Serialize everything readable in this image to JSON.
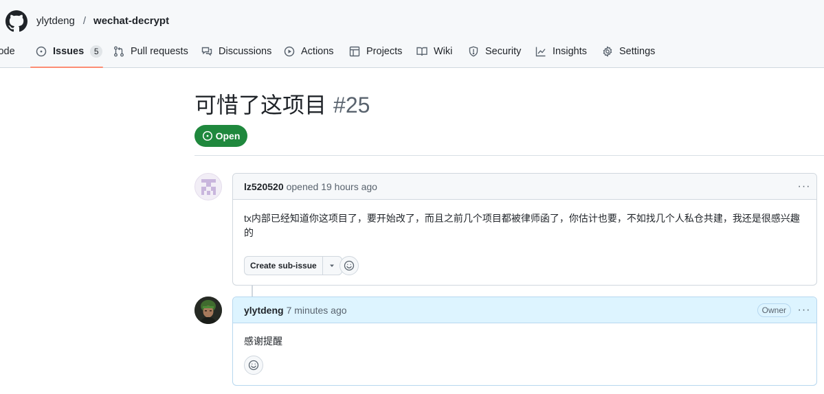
{
  "repo": {
    "owner": "ylytdeng",
    "separator": "/",
    "name": "wechat-decrypt"
  },
  "tabs": [
    {
      "label": "Code",
      "icon": "code-icon"
    },
    {
      "label": "Issues",
      "icon": "issue-opened-icon",
      "counter": "5",
      "active": true
    },
    {
      "label": "Pull requests",
      "icon": "git-pull-request-icon"
    },
    {
      "label": "Discussions",
      "icon": "comment-discussion-icon"
    },
    {
      "label": "Actions",
      "icon": "play-icon"
    },
    {
      "label": "Projects",
      "icon": "table-icon"
    },
    {
      "label": "Wiki",
      "icon": "book-icon"
    },
    {
      "label": "Security",
      "icon": "shield-icon"
    },
    {
      "label": "Insights",
      "icon": "graph-icon"
    },
    {
      "label": "Settings",
      "icon": "gear-icon"
    }
  ],
  "issue": {
    "title": "可惜了这项目",
    "number": "#25",
    "state": "Open"
  },
  "comments": [
    {
      "author": "lz520520",
      "meta": "opened 19 hours ago",
      "body": "tx内部已经知道你这项目了，要开始改了，而且之前几个项目都被律师函了，你估计也要，不如找几个人私仓共建，我还是很感兴趣的",
      "sub_issue_label": "Create sub-issue",
      "menu": "···"
    },
    {
      "author": "ylytdeng",
      "meta": "7 minutes ago",
      "role": "Owner",
      "body": "感谢提醒",
      "menu": "···"
    }
  ],
  "colors": {
    "open_green": "#1f883d",
    "tab_underline": "#fd8c73",
    "owner_header": "#ddf4ff",
    "border": "#d0d7de"
  }
}
